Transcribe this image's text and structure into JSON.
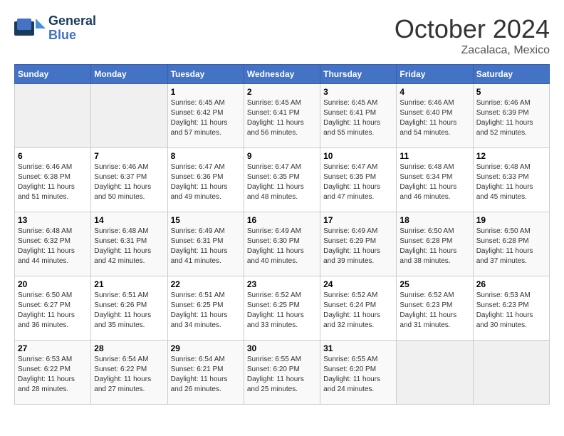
{
  "header": {
    "logo_line1": "General",
    "logo_line2": "Blue",
    "month": "October 2024",
    "location": "Zacalaca, Mexico"
  },
  "weekdays": [
    "Sunday",
    "Monday",
    "Tuesday",
    "Wednesday",
    "Thursday",
    "Friday",
    "Saturday"
  ],
  "weeks": [
    [
      {
        "day": "",
        "info": ""
      },
      {
        "day": "",
        "info": ""
      },
      {
        "day": "1",
        "info": "Sunrise: 6:45 AM\nSunset: 6:42 PM\nDaylight: 11 hours and 57 minutes."
      },
      {
        "day": "2",
        "info": "Sunrise: 6:45 AM\nSunset: 6:41 PM\nDaylight: 11 hours and 56 minutes."
      },
      {
        "day": "3",
        "info": "Sunrise: 6:45 AM\nSunset: 6:41 PM\nDaylight: 11 hours and 55 minutes."
      },
      {
        "day": "4",
        "info": "Sunrise: 6:46 AM\nSunset: 6:40 PM\nDaylight: 11 hours and 54 minutes."
      },
      {
        "day": "5",
        "info": "Sunrise: 6:46 AM\nSunset: 6:39 PM\nDaylight: 11 hours and 52 minutes."
      }
    ],
    [
      {
        "day": "6",
        "info": "Sunrise: 6:46 AM\nSunset: 6:38 PM\nDaylight: 11 hours and 51 minutes."
      },
      {
        "day": "7",
        "info": "Sunrise: 6:46 AM\nSunset: 6:37 PM\nDaylight: 11 hours and 50 minutes."
      },
      {
        "day": "8",
        "info": "Sunrise: 6:47 AM\nSunset: 6:36 PM\nDaylight: 11 hours and 49 minutes."
      },
      {
        "day": "9",
        "info": "Sunrise: 6:47 AM\nSunset: 6:35 PM\nDaylight: 11 hours and 48 minutes."
      },
      {
        "day": "10",
        "info": "Sunrise: 6:47 AM\nSunset: 6:35 PM\nDaylight: 11 hours and 47 minutes."
      },
      {
        "day": "11",
        "info": "Sunrise: 6:48 AM\nSunset: 6:34 PM\nDaylight: 11 hours and 46 minutes."
      },
      {
        "day": "12",
        "info": "Sunrise: 6:48 AM\nSunset: 6:33 PM\nDaylight: 11 hours and 45 minutes."
      }
    ],
    [
      {
        "day": "13",
        "info": "Sunrise: 6:48 AM\nSunset: 6:32 PM\nDaylight: 11 hours and 44 minutes."
      },
      {
        "day": "14",
        "info": "Sunrise: 6:48 AM\nSunset: 6:31 PM\nDaylight: 11 hours and 42 minutes."
      },
      {
        "day": "15",
        "info": "Sunrise: 6:49 AM\nSunset: 6:31 PM\nDaylight: 11 hours and 41 minutes."
      },
      {
        "day": "16",
        "info": "Sunrise: 6:49 AM\nSunset: 6:30 PM\nDaylight: 11 hours and 40 minutes."
      },
      {
        "day": "17",
        "info": "Sunrise: 6:49 AM\nSunset: 6:29 PM\nDaylight: 11 hours and 39 minutes."
      },
      {
        "day": "18",
        "info": "Sunrise: 6:50 AM\nSunset: 6:28 PM\nDaylight: 11 hours and 38 minutes."
      },
      {
        "day": "19",
        "info": "Sunrise: 6:50 AM\nSunset: 6:28 PM\nDaylight: 11 hours and 37 minutes."
      }
    ],
    [
      {
        "day": "20",
        "info": "Sunrise: 6:50 AM\nSunset: 6:27 PM\nDaylight: 11 hours and 36 minutes."
      },
      {
        "day": "21",
        "info": "Sunrise: 6:51 AM\nSunset: 6:26 PM\nDaylight: 11 hours and 35 minutes."
      },
      {
        "day": "22",
        "info": "Sunrise: 6:51 AM\nSunset: 6:25 PM\nDaylight: 11 hours and 34 minutes."
      },
      {
        "day": "23",
        "info": "Sunrise: 6:52 AM\nSunset: 6:25 PM\nDaylight: 11 hours and 33 minutes."
      },
      {
        "day": "24",
        "info": "Sunrise: 6:52 AM\nSunset: 6:24 PM\nDaylight: 11 hours and 32 minutes."
      },
      {
        "day": "25",
        "info": "Sunrise: 6:52 AM\nSunset: 6:23 PM\nDaylight: 11 hours and 31 minutes."
      },
      {
        "day": "26",
        "info": "Sunrise: 6:53 AM\nSunset: 6:23 PM\nDaylight: 11 hours and 30 minutes."
      }
    ],
    [
      {
        "day": "27",
        "info": "Sunrise: 6:53 AM\nSunset: 6:22 PM\nDaylight: 11 hours and 28 minutes."
      },
      {
        "day": "28",
        "info": "Sunrise: 6:54 AM\nSunset: 6:22 PM\nDaylight: 11 hours and 27 minutes."
      },
      {
        "day": "29",
        "info": "Sunrise: 6:54 AM\nSunset: 6:21 PM\nDaylight: 11 hours and 26 minutes."
      },
      {
        "day": "30",
        "info": "Sunrise: 6:55 AM\nSunset: 6:20 PM\nDaylight: 11 hours and 25 minutes."
      },
      {
        "day": "31",
        "info": "Sunrise: 6:55 AM\nSunset: 6:20 PM\nDaylight: 11 hours and 24 minutes."
      },
      {
        "day": "",
        "info": ""
      },
      {
        "day": "",
        "info": ""
      }
    ]
  ]
}
